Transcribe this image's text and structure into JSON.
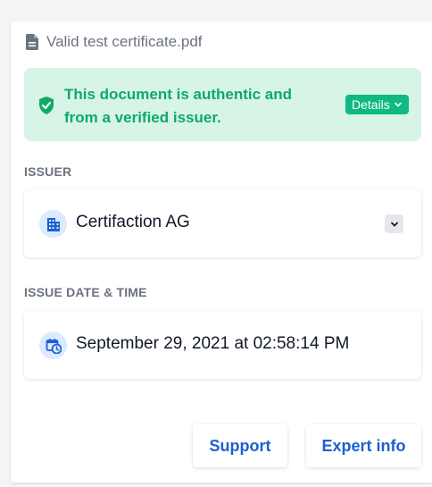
{
  "document": {
    "filename": "Valid test certificate.pdf",
    "file_icon": "document-icon"
  },
  "verification": {
    "message": "This document is authentic and from a verified issuer.",
    "icon": "shield-check-icon",
    "details_label": "Details",
    "color_text": "#0fa968",
    "color_bg": "#d7f5e6",
    "color_button": "#10b981"
  },
  "issuer": {
    "label": "ISSUER",
    "name": "Certifaction AG",
    "icon": "building-icon"
  },
  "issue_date": {
    "label": "ISSUE DATE & TIME",
    "value": "September 29, 2021 at 02:58:14 PM",
    "icon": "calendar-clock-icon"
  },
  "actions": {
    "support_label": "Support",
    "expert_label": "Expert info",
    "color": "#1d5fd1"
  }
}
